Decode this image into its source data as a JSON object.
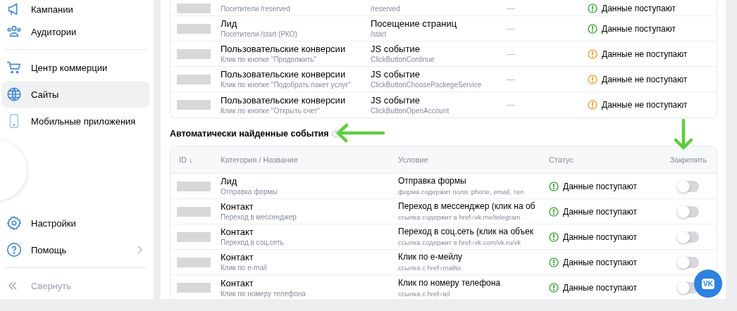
{
  "sidebar": {
    "top_items": [
      {
        "label": "Кампании",
        "selected": false
      },
      {
        "label": "Аудитории",
        "selected": false
      },
      {
        "label": "Центр коммерции",
        "selected": false
      },
      {
        "label": "Сайты",
        "selected": true
      },
      {
        "label": "Мобильные приложения",
        "selected": false
      }
    ],
    "bottom_items": [
      {
        "label": "Настройки",
        "selected": false,
        "has_submenu": false
      },
      {
        "label": "Помощь",
        "selected": false,
        "has_submenu": true
      }
    ],
    "collapse": {
      "label": "Свернуть"
    }
  },
  "events_table": {
    "rows": [
      {
        "subtitle": "Посетители /reserved",
        "condition_detail": "/reserved",
        "value": "—",
        "status": {
          "text": "Данные поступают",
          "color": "#4bb34b"
        }
      },
      {
        "title": "Лид",
        "subtitle": "Посетители /start (РКО)",
        "condition": "Посещение страниц",
        "condition_detail": "/start",
        "value": "—",
        "status": {
          "text": "Данные поступают",
          "color": "#4bb34b"
        }
      },
      {
        "title": "Пользовательские конверсии",
        "subtitle": "Клик по кнопке \"Продолжить\"",
        "condition": "JS событие",
        "condition_detail": "ClickButtonContinue",
        "value": "—",
        "status": {
          "text": "Данные не поступают",
          "color": "#f4a93c"
        }
      },
      {
        "title": "Пользовательские конверсии",
        "subtitle": "Клик по кнопке \"Подобрать пакет услуг\"",
        "condition": "JS событие",
        "condition_detail": "ClickButtonChoosePackegeService",
        "value": "—",
        "status": {
          "text": "Данные не поступают",
          "color": "#f4a93c"
        }
      },
      {
        "title": "Пользовательские конверсии",
        "subtitle": "Клик по кнопке \"Открыть счет\"",
        "condition": "JS событие",
        "condition_detail": "ClickButtonOpenAccount",
        "value": "—",
        "status": {
          "text": "Данные не поступают",
          "color": "#f4a93c"
        }
      }
    ]
  },
  "auto_events": {
    "title": "Автоматически найденные события",
    "columns": [
      "ID ↓",
      "Категория / Название",
      "Условие",
      "Статус",
      "Закрепить"
    ],
    "rows": [
      {
        "title": "Лид",
        "subtitle": "Отправка формы",
        "condition": "Отправка формы",
        "condition_detail": "форма содержит поля: phone, email, тел",
        "status": {
          "text": "Данные поступают",
          "color": "#4bb34b"
        },
        "pinned": false
      },
      {
        "title": "Контакт",
        "subtitle": "Переход в мессенджер",
        "condition": "Переход в мессенджер (клик на об",
        "condition_detail": "ссылка содержит в href=vk.me/telegram",
        "status": {
          "text": "Данные поступают",
          "color": "#4bb34b"
        },
        "pinned": false
      },
      {
        "title": "Контакт",
        "subtitle": "Переход в соц.сеть",
        "condition": "Переход в соц.сеть (клик на объек",
        "condition_detail": "ссылка содержит в href=vk.com/vk.ru/vk",
        "status": {
          "text": "Данные поступают",
          "color": "#4bb34b"
        },
        "pinned": false
      },
      {
        "title": "Контакт",
        "subtitle": "Клик по e-mail",
        "condition": "Клик по е-мейлу",
        "condition_detail": "ссылка с href=mailto",
        "status": {
          "text": "Данные поступают",
          "color": "#4bb34b"
        },
        "pinned": false
      },
      {
        "title": "Контакт",
        "subtitle": "Клик по номеру телефона",
        "condition": "Клик по номеру телефона",
        "condition_detail": "ссылка с href=tel",
        "status": {
          "text": "Данные поступают",
          "color": "#4bb34b"
        },
        "pinned": false
      }
    ]
  },
  "chat_button": {
    "label": "VK"
  }
}
